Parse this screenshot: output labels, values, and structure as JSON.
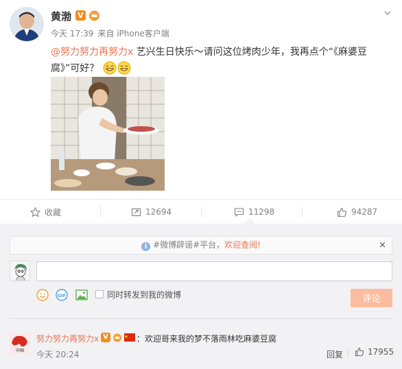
{
  "post": {
    "username": "黄渤",
    "badge_v": "V",
    "time": "今天 17:39",
    "source": "来自 iPhone客户端",
    "mention": "@努力努力再努力x",
    "text": " 艺兴生日快乐～请问这位烤肉少年，我再点个“《麻婆豆腐》”可好？"
  },
  "actions": {
    "favorite_label": "收藏",
    "repost_count": "12694",
    "comment_count": "11298",
    "like_count": "94287"
  },
  "comment_panel": {
    "notice_tag": "#微博辟谣#平台，",
    "notice_link": "欢迎查阅!",
    "notice_close": "×",
    "input_value": "",
    "repost_label": "同时转发到我的微博",
    "submit_label": "评论"
  },
  "comments": [
    {
      "user": "努力努力再努力x",
      "badge_v": "V",
      "text": "：欢迎哥来我的梦不落雨林吃麻婆豆腐",
      "time": "今天 20:24",
      "reply_label": "回复",
      "likes": "17955"
    }
  ],
  "icons": {
    "more": "chevron-down-icon",
    "favorite": "star-icon",
    "repost": "repost-icon",
    "comment": "comment-icon",
    "like": "thumbs-up-icon",
    "emoji": "emoji-icon",
    "gif": "gif-icon",
    "image": "image-icon"
  },
  "colors": {
    "accent": "#eb7350",
    "badge": "#f28c1d",
    "panel_bg": "#f2f2f5",
    "submit_bg": "#fbbd9f"
  }
}
